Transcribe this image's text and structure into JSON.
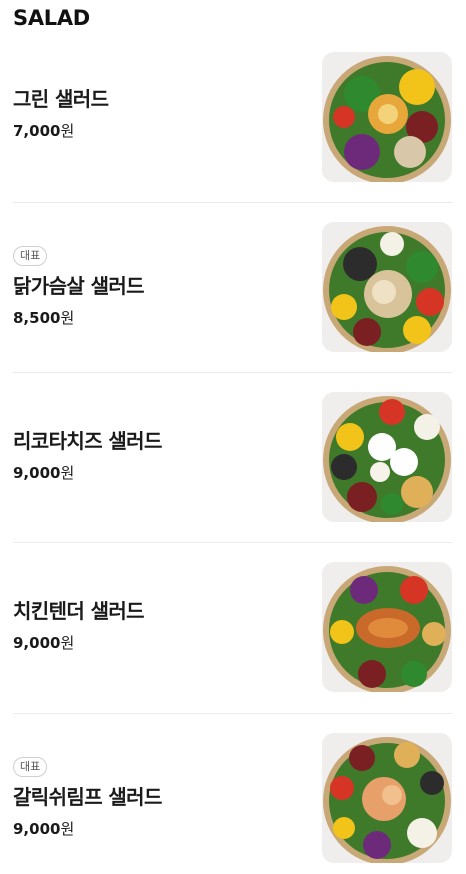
{
  "section": {
    "title": "SALAD"
  },
  "items": [
    {
      "badge": "",
      "name": "그린 샐러드",
      "price": "7,000",
      "currency": "원",
      "image_icon": "green-salad-bowl-image"
    },
    {
      "badge": "대표",
      "name": "닭가슴살 샐러드",
      "price": "8,500",
      "currency": "원",
      "image_icon": "chicken-breast-salad-bowl-image"
    },
    {
      "badge": "",
      "name": "리코타치즈 샐러드",
      "price": "9,000",
      "currency": "원",
      "image_icon": "ricotta-cheese-salad-bowl-image"
    },
    {
      "badge": "",
      "name": "치킨텐더 샐러드",
      "price": "9,000",
      "currency": "원",
      "image_icon": "chicken-tender-salad-bowl-image"
    },
    {
      "badge": "대표",
      "name": "갈릭쉬림프 샐러드",
      "price": "9,000",
      "currency": "원",
      "image_icon": "garlic-shrimp-salad-bowl-image"
    }
  ]
}
